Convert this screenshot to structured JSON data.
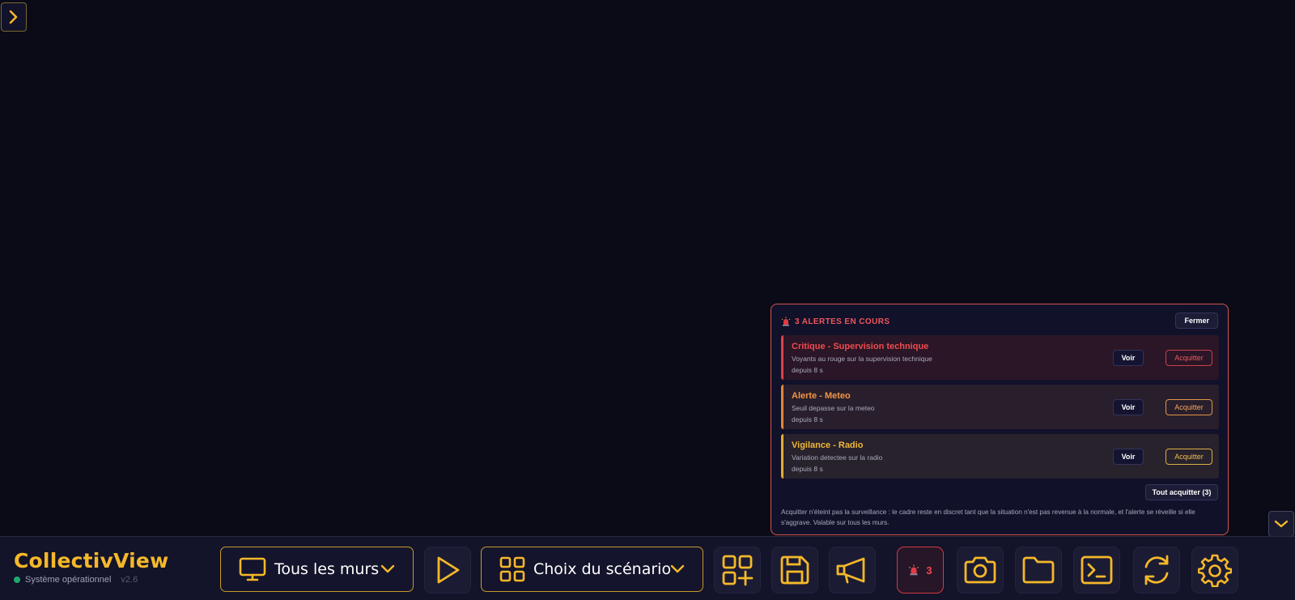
{
  "colors": {
    "accent": "#f5b829",
    "critical": "#ef4b50",
    "warning": "#f29545",
    "vigilance": "#f0b83a",
    "status_ok": "#1fa86b",
    "background": "#0b0b17"
  },
  "alerts": {
    "title": "3 ALERTES EN COURS",
    "close_label": "Fermer",
    "items": [
      {
        "title": "Critique - Supervision technique",
        "description": "Voyants au rouge sur la supervision technique",
        "time": "depuis 8 s",
        "view_label": "Voir",
        "ack_label": "Acquitter",
        "level": "critique"
      },
      {
        "title": "Alerte - Meteo",
        "description": "Seuil depasse sur la meteo",
        "time": "depuis 8 s",
        "view_label": "Voir",
        "ack_label": "Acquitter",
        "level": "alerte"
      },
      {
        "title": "Vigilance - Radio",
        "description": "Variation detectee sur la radio",
        "time": "depuis 8 s",
        "view_label": "Voir",
        "ack_label": "Acquitter",
        "level": "vigilance"
      }
    ],
    "ack_all_label": "Tout acquitter (3)",
    "note": "Acquitter n'éteint pas la surveillance : le cadre reste en discret tant que la situation n'est pas revenue à la normale, et l'alerte se réveille si elle s'aggrave. Valable sur tous les murs."
  },
  "bottombar": {
    "brand": "CollectivView",
    "status": "Système opérationnel",
    "version": "v2.6",
    "walls_dropdown": {
      "label": "Tous les murs",
      "icon": "monitor-icon"
    },
    "scenario_dropdown": {
      "label": "Choix du scénario",
      "icon": "grid-icon"
    },
    "alarm_count": "3",
    "icons": [
      "play-icon",
      "add-layout-icon",
      "save-icon",
      "megaphone-icon",
      "alarm-icon",
      "camera-icon",
      "folder-icon",
      "terminal-icon",
      "refresh-icon",
      "settings-icon"
    ]
  }
}
